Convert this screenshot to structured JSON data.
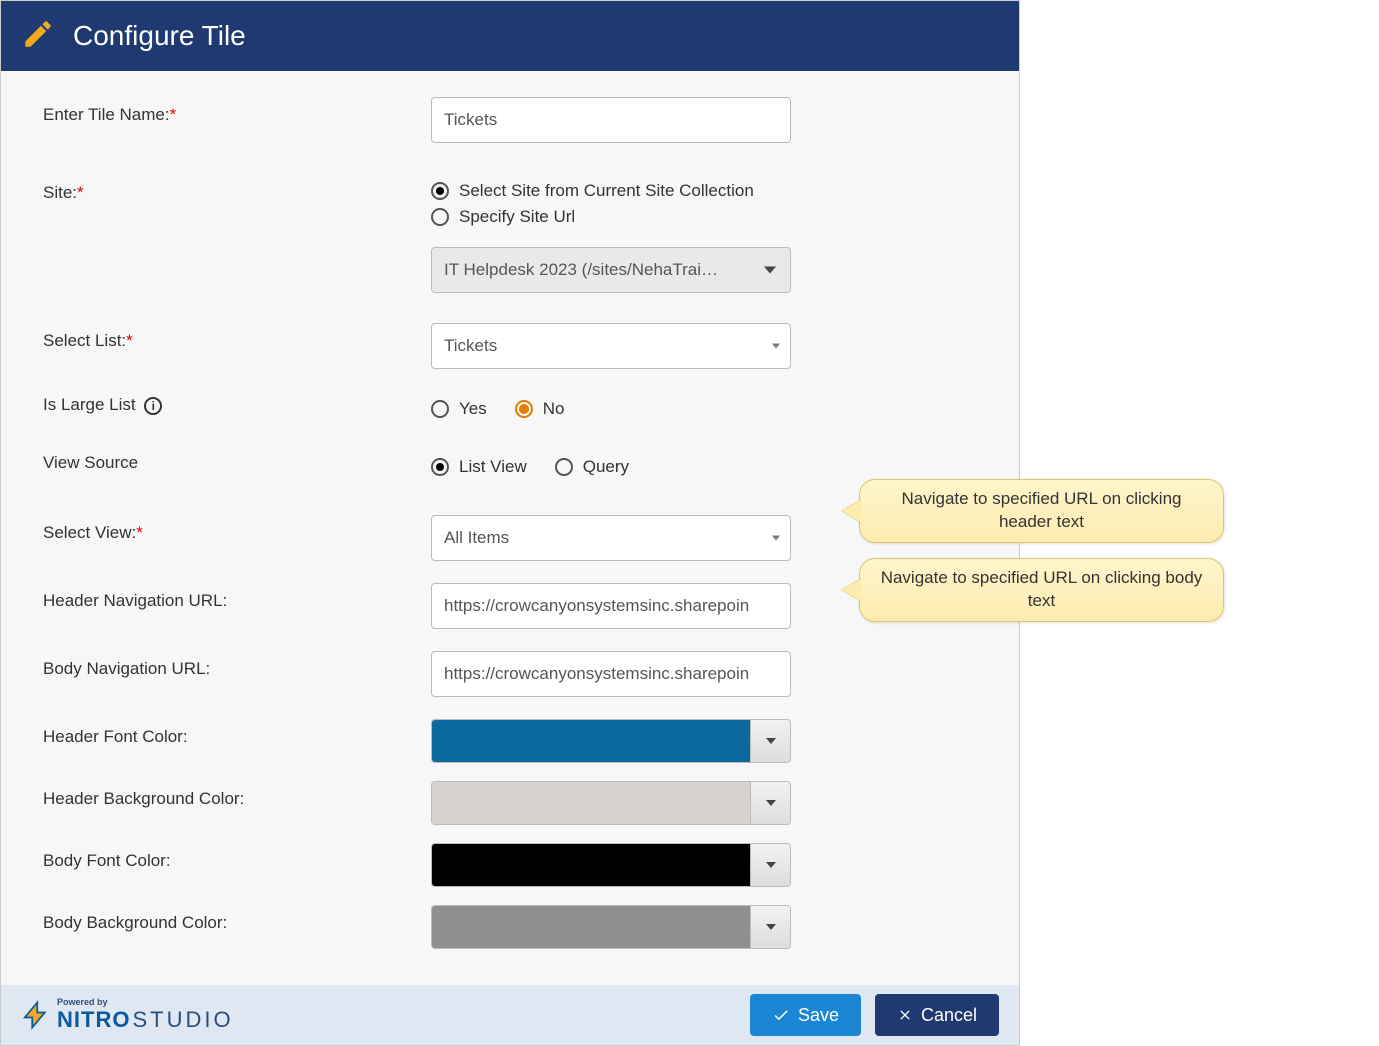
{
  "header": {
    "title": "Configure Tile"
  },
  "fields": {
    "tileName": {
      "label": "Enter Tile Name:",
      "value": "Tickets"
    },
    "site": {
      "label": "Site:",
      "opt1": "Select Site from Current Site Collection",
      "opt2": "Specify Site Url",
      "dropdown": "IT Helpdesk 2023 (/sites/NehaTrai…"
    },
    "selectList": {
      "label": "Select List:",
      "value": "Tickets"
    },
    "largeList": {
      "label": "Is Large List",
      "yes": "Yes",
      "no": "No"
    },
    "viewSource": {
      "label": "View Source",
      "listView": "List View",
      "query": "Query"
    },
    "selectView": {
      "label": "Select View:",
      "value": "All Items"
    },
    "headerNav": {
      "label": "Header Navigation URL:",
      "value": "https://crowcanyonsystemsinc.sharepoin"
    },
    "bodyNav": {
      "label": "Body Navigation URL:",
      "value": "https://crowcanyonsystemsinc.sharepoin"
    },
    "headerFont": {
      "label": "Header Font Color:",
      "color": "#0a6aa0"
    },
    "headerBg": {
      "label": "Header Background Color:",
      "color": "#d6d2ce"
    },
    "bodyFont": {
      "label": "Body Font Color:",
      "color": "#000000"
    },
    "bodyBg": {
      "label": "Body Background Color:",
      "color": "#8f8f8f"
    }
  },
  "callouts": {
    "header": "Navigate to specified URL on clicking header text",
    "body": "Navigate to specified URL on clicking body text"
  },
  "footer": {
    "powered": "Powered by",
    "brand1": "NITRO",
    "brand2": "STUDIO",
    "save": "Save",
    "cancel": "Cancel"
  }
}
